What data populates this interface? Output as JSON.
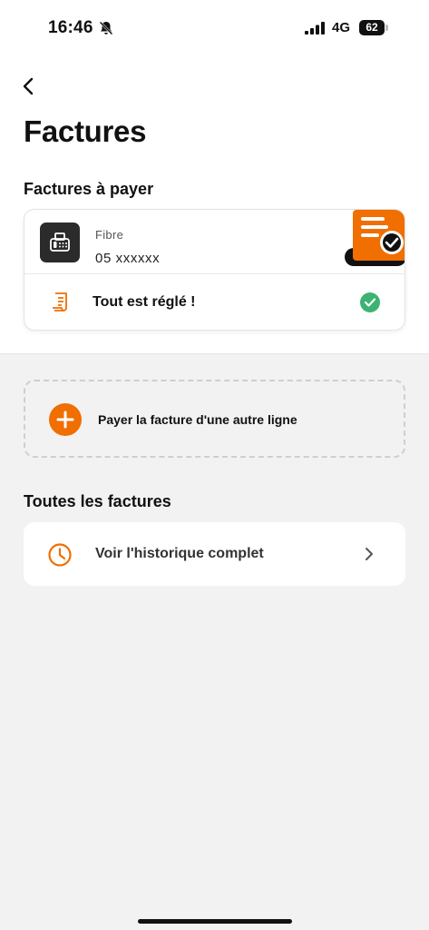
{
  "status_bar": {
    "time": "16:46",
    "network": "4G",
    "battery": "62"
  },
  "header": {
    "title": "Factures"
  },
  "bills_to_pay": {
    "section_title": "Factures à payer",
    "line_type": "Fibre",
    "line_number": "05 xxxxxx",
    "status_text": "Tout est réglé !"
  },
  "pay_other": {
    "label": "Payer la facture d'une autre ligne"
  },
  "all_bills": {
    "section_title": "Toutes les factures",
    "history_label": "Voir l'historique complet"
  },
  "icons": {
    "back": "chevron-left-icon",
    "line": "fax-icon",
    "status": "receipt-icon",
    "settled": "check-circle-icon",
    "add": "plus-circle-icon",
    "history": "clock-icon",
    "open": "chevron-right-icon"
  },
  "colors": {
    "accent": "#f16e00",
    "success": "#3cb371",
    "background": "#f2f2f2"
  }
}
